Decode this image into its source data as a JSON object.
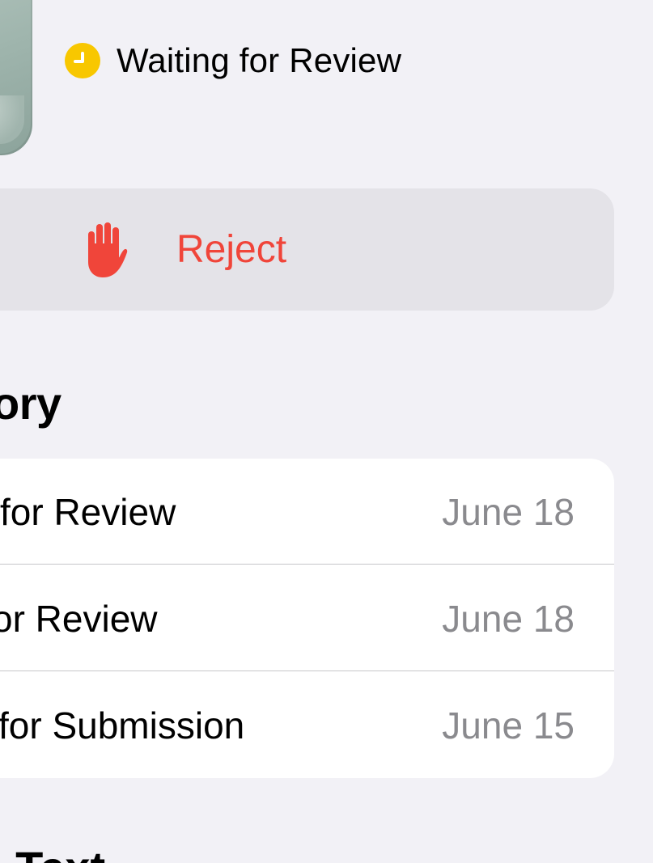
{
  "status": {
    "icon": "clock-icon",
    "color": "#f8c700",
    "text": "Waiting for Review"
  },
  "reject_button": {
    "icon": "hand-raised-icon",
    "label": "Reject",
    "color": "#f0453a"
  },
  "history": {
    "title": "ory",
    "rows": [
      {
        "title": "for Review",
        "date": "June 18"
      },
      {
        "title": "or Review",
        "date": "June 18"
      },
      {
        "title": " for Submission",
        "date": "June 15"
      }
    ]
  },
  "bottom_section": {
    "title": "l Text"
  }
}
